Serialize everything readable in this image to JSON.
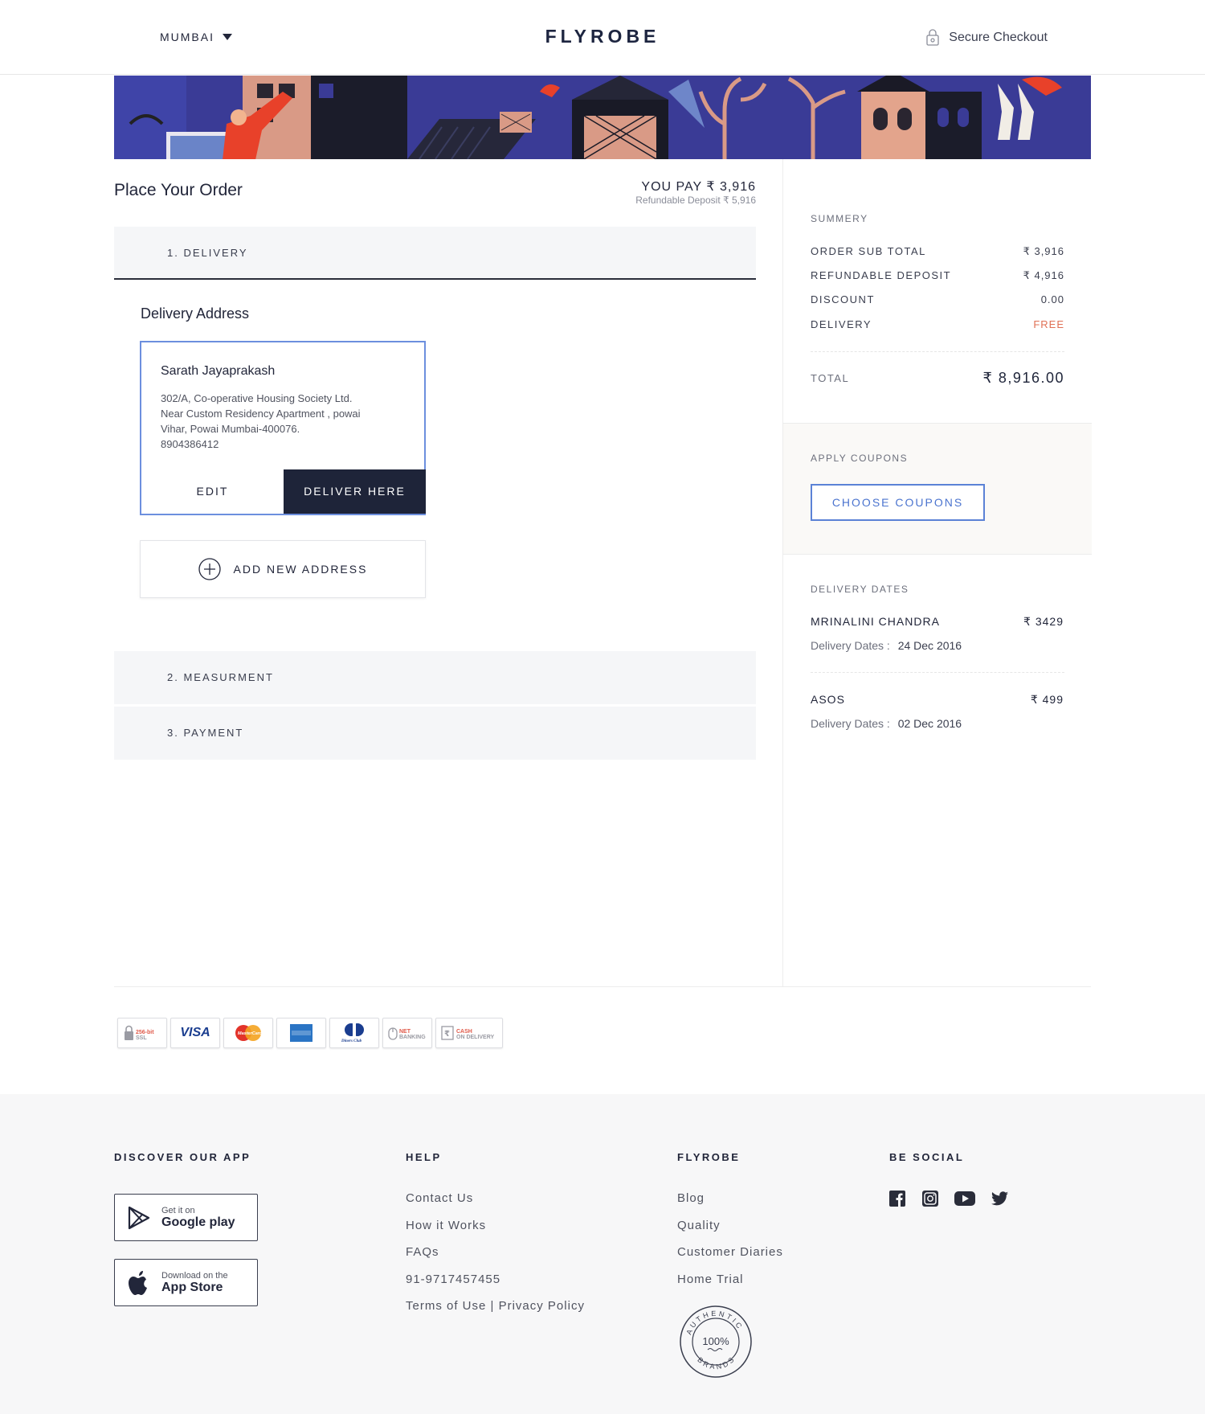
{
  "header": {
    "city": "MUMBAI",
    "logo": "FLYROBE",
    "secure": "Secure Checkout"
  },
  "order": {
    "title": "Place Your Order",
    "you_pay": "YOU PAY ₹ 3,916",
    "deposit_note": "Refundable Deposit ₹ 5,916"
  },
  "steps": [
    {
      "label": "1. DELIVERY"
    },
    {
      "label": "2. MEASURMENT"
    },
    {
      "label": "3. PAYMENT"
    }
  ],
  "delivery": {
    "heading": "Delivery Address",
    "address": {
      "name": "Sarath Jayaprakash",
      "line1": "302/A, Co-operative Housing Society Ltd.",
      "line2": "Near Custom Residency Apartment ,  powai",
      "line3": "Vihar, Powai Mumbai-400076.",
      "phone": "8904386412",
      "edit_label": "EDIT",
      "deliver_label": "DELIVER HERE"
    },
    "add_new_label": "ADD NEW ADDRESS"
  },
  "summary": {
    "heading": "SUMMERY",
    "rows": [
      {
        "label": "ORDER SUB TOTAL",
        "value": "₹ 3,916"
      },
      {
        "label": "REFUNDABLE DEPOSIT",
        "value": "₹ 4,916"
      },
      {
        "label": "DISCOUNT",
        "value": "0.00"
      },
      {
        "label": "DELIVERY",
        "value": "FREE"
      }
    ],
    "total_label": "TOTAL",
    "total_value": "₹ 8,916.00"
  },
  "coupons": {
    "heading": "APPLY COUPONS",
    "button": "CHOOSE COUPONS"
  },
  "delivery_dates": {
    "heading": "DELIVERY DATES",
    "items": [
      {
        "name": "MRINALINI CHANDRA",
        "price": "₹ 3429",
        "date_label": "Delivery Dates :",
        "date": "24 Dec 2016"
      },
      {
        "name": "ASOS",
        "price": "₹ 499",
        "date_label": "Delivery Dates :",
        "date": "02 Dec 2016"
      }
    ]
  },
  "payment_icons": [
    {
      "name": "ssl",
      "label": "256-bit SSL"
    },
    {
      "name": "visa",
      "label": "VISA"
    },
    {
      "name": "mastercard",
      "label": "MasterCard"
    },
    {
      "name": "amex",
      "label": "AMERICAN EXPRESS"
    },
    {
      "name": "diners",
      "label": "Diners Club International"
    },
    {
      "name": "net-banking",
      "label": "NET BANKING"
    },
    {
      "name": "cod",
      "label": "CASH ON DELIVERY"
    }
  ],
  "footer": {
    "app_heading": "DISCOVER OUR APP",
    "google_small": "Get it on",
    "google_big": "Google play",
    "apple_small": "Download on the",
    "apple_big": "App Store",
    "help_heading": "HELP",
    "help_links": [
      "Contact Us",
      "How it Works",
      "FAQs",
      "91-9717457455",
      "Terms of Use | Privacy Policy"
    ],
    "flyrobe_heading": "FLYROBE",
    "flyrobe_links": [
      "Blog",
      "Quality",
      "Customer Diaries",
      "Home Trial"
    ],
    "badge": {
      "top": "AUTHENTIC",
      "center": "100%",
      "bottom": "BRANDS"
    },
    "social_heading": "BE SOCIAL"
  },
  "colors": {
    "navy": "#1e2439",
    "accent_blue": "#4b74cf",
    "free_orange": "#e07055",
    "banner_blue": "#3b3d9a"
  }
}
